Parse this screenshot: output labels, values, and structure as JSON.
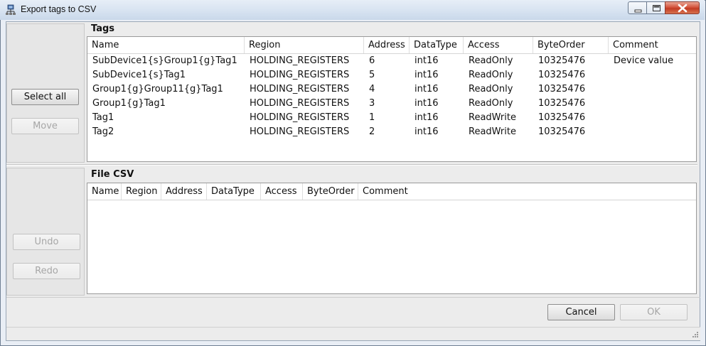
{
  "window": {
    "title": "Export tags to CSV",
    "icons": {
      "app": "cube-network-icon",
      "minimize": "minimize-icon",
      "maximize": "maximize-icon",
      "close": "close-icon"
    }
  },
  "left_panel": {
    "select_all": "Select all",
    "move": "Move",
    "undo": "Undo",
    "redo": "Redo"
  },
  "tags": {
    "title": "Tags",
    "columns": [
      "Name",
      "Region",
      "Address",
      "DataType",
      "Access",
      "ByteOrder",
      "Comment"
    ],
    "rows": [
      [
        "SubDevice1{s}Group1{g}Tag1",
        "HOLDING_REGISTERS",
        "6",
        "int16",
        "ReadOnly",
        "10325476",
        "Device value"
      ],
      [
        "SubDevice1{s}Tag1",
        "HOLDING_REGISTERS",
        "5",
        "int16",
        "ReadOnly",
        "10325476",
        ""
      ],
      [
        "Group1{g}Group11{g}Tag1",
        "HOLDING_REGISTERS",
        "4",
        "int16",
        "ReadOnly",
        "10325476",
        ""
      ],
      [
        "Group1{g}Tag1",
        "HOLDING_REGISTERS",
        "3",
        "int16",
        "ReadOnly",
        "10325476",
        ""
      ],
      [
        "Tag1",
        "HOLDING_REGISTERS",
        "1",
        "int16",
        "ReadWrite",
        "10325476",
        ""
      ],
      [
        "Tag2",
        "HOLDING_REGISTERS",
        "2",
        "int16",
        "ReadWrite",
        "10325476",
        ""
      ]
    ]
  },
  "csv": {
    "title": "File CSV",
    "columns": [
      "Name",
      "Region",
      "Address",
      "DataType",
      "Access",
      "ByteOrder",
      "Comment"
    ],
    "rows": []
  },
  "footer": {
    "cancel": "Cancel",
    "ok": "OK"
  },
  "colors": {
    "titlebar": "#d7e3f1",
    "close_button": "#c23c24",
    "client_bg": "#ececec",
    "disabled_text": "#a6a6a6"
  }
}
